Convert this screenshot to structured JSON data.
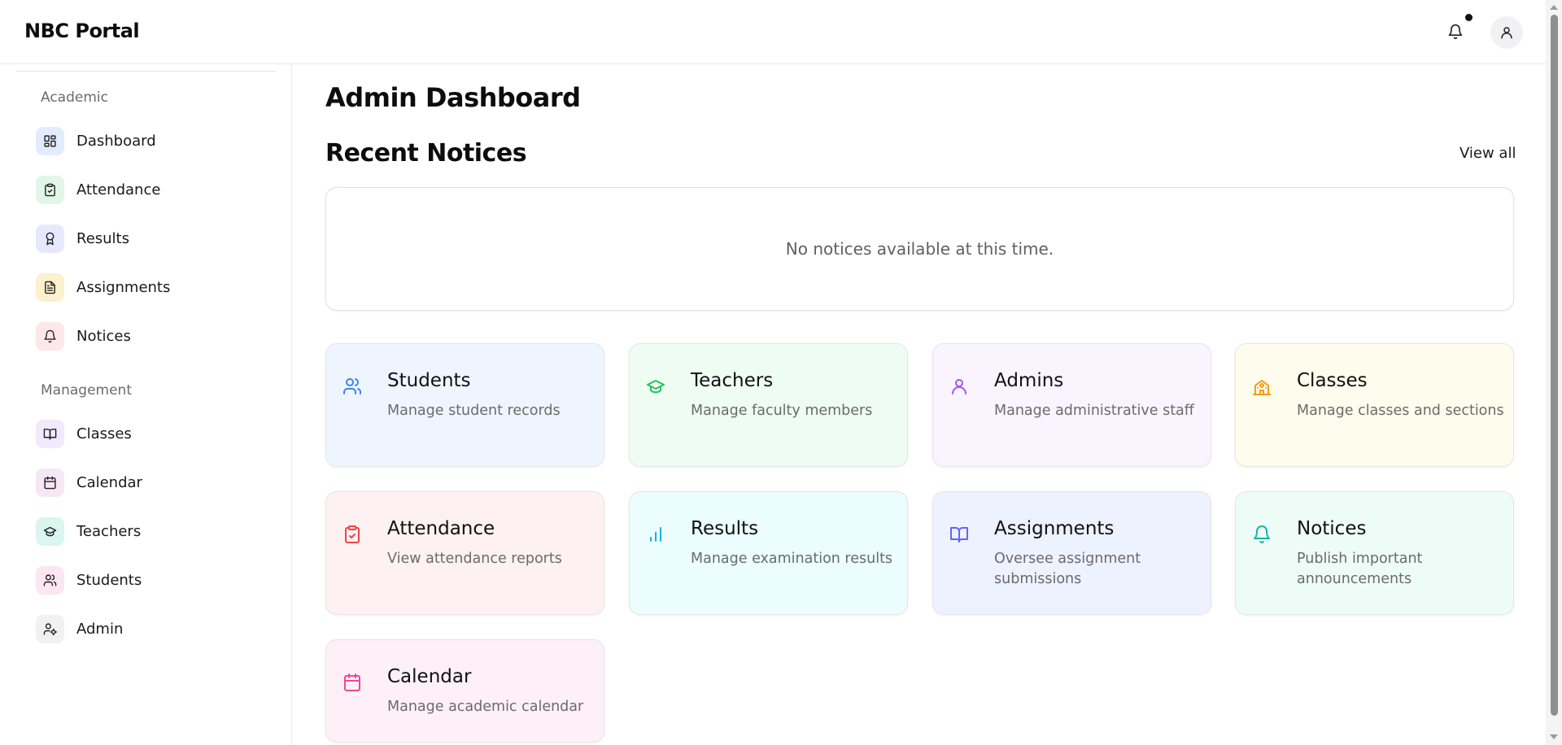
{
  "header": {
    "brand": "NBC Portal",
    "notification_icon": "bell-icon",
    "profile_icon": "user-icon"
  },
  "sidebar": {
    "sections": [
      {
        "label": "Academic",
        "items": [
          {
            "label": "Dashboard",
            "icon": "dashboard-icon",
            "bg": "#e3ecfc"
          },
          {
            "label": "Attendance",
            "icon": "clipboard-check-icon",
            "bg": "#e2f6e8"
          },
          {
            "label": "Results",
            "icon": "award-icon",
            "bg": "#e5e9fb"
          },
          {
            "label": "Assignments",
            "icon": "file-text-icon",
            "bg": "#fbf1cf"
          },
          {
            "label": "Notices",
            "icon": "bell-icon",
            "bg": "#fde6ec"
          }
        ]
      },
      {
        "label": "Management",
        "items": [
          {
            "label": "Classes",
            "icon": "book-open-icon",
            "bg": "#f1e9fc"
          },
          {
            "label": "Calendar",
            "icon": "calendar-icon",
            "bg": "#f6e7f7"
          },
          {
            "label": "Teachers",
            "icon": "graduation-cap-icon",
            "bg": "#dbf5ef"
          },
          {
            "label": "Students",
            "icon": "users-icon",
            "bg": "#fce6ef"
          },
          {
            "label": "Admin",
            "icon": "user-cog-icon",
            "bg": "#f1f1f2"
          }
        ]
      }
    ]
  },
  "main": {
    "title": "Admin Dashboard",
    "notices": {
      "title": "Recent Notices",
      "view_all": "View all",
      "empty": "No notices available at this time."
    },
    "cards": [
      {
        "title": "Students",
        "desc": "Manage student records",
        "icon": "users-icon",
        "color": "#3b82f6",
        "bg": "#eff5ff"
      },
      {
        "title": "Teachers",
        "desc": "Manage faculty members",
        "icon": "graduation-cap-icon",
        "color": "#22c55e",
        "bg": "#effcf3"
      },
      {
        "title": "Admins",
        "desc": "Manage administrative staff",
        "icon": "user-icon",
        "color": "#a855f7",
        "bg": "#f9f4ff"
      },
      {
        "title": "Classes",
        "desc": "Manage classes and sections",
        "icon": "school-icon",
        "color": "#f59e0b",
        "bg": "#fefcec"
      },
      {
        "title": "Attendance",
        "desc": "View attendance reports",
        "icon": "clipboard-check-icon",
        "color": "#ef4444",
        "bg": "#fef1f1"
      },
      {
        "title": "Results",
        "desc": "Manage examination results",
        "icon": "bar-chart-icon",
        "color": "#06b6d4",
        "bg": "#ebfdfe"
      },
      {
        "title": "Assignments",
        "desc": "Oversee assignment submissions",
        "icon": "book-open-icon",
        "color": "#6366f1",
        "bg": "#eef1fe"
      },
      {
        "title": "Notices",
        "desc": "Publish important announcements",
        "icon": "bell-icon",
        "color": "#14b8a6",
        "bg": "#eefcf8"
      },
      {
        "title": "Calendar",
        "desc": "Manage academic calendar",
        "icon": "calendar-icon",
        "color": "#ec4899",
        "bg": "#fdf1f7"
      }
    ]
  }
}
